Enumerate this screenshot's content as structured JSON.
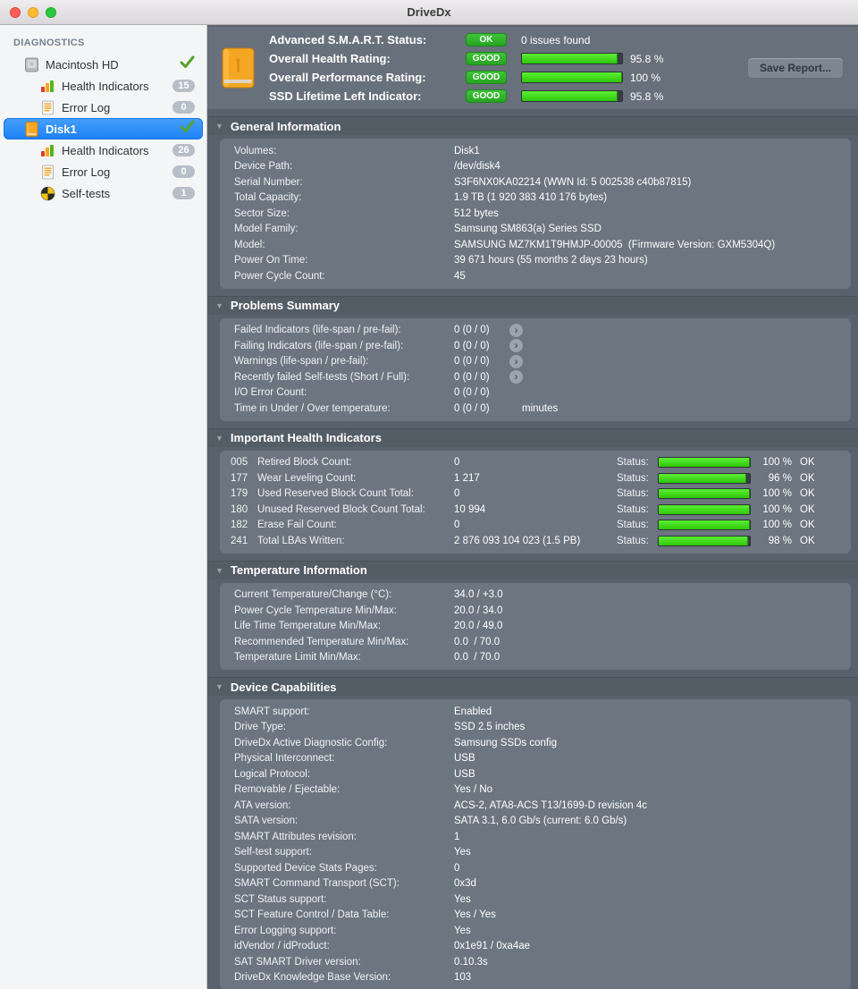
{
  "window": {
    "title": "DriveDx"
  },
  "colors": {
    "selection_blue": "#1d80f6",
    "badge_green": "#2fb529",
    "bar_green": "#3bd51c",
    "content_bg": "#59616c",
    "panel_bg": "#6c7580",
    "sidebar_bg": "#f4f5f7"
  },
  "sidebar": {
    "header": "DIAGNOSTICS",
    "items": [
      {
        "label": "Macintosh HD",
        "icon": "internal-drive",
        "level": 0,
        "check": true,
        "selected": false
      },
      {
        "label": "Health Indicators",
        "icon": "health-bars",
        "level": 1,
        "badge": "15",
        "selected": false
      },
      {
        "label": "Error Log",
        "icon": "error-log",
        "level": 1,
        "badge": "0",
        "selected": false
      },
      {
        "label": "Disk1",
        "icon": "external-drive",
        "level": 0,
        "check": true,
        "selected": true
      },
      {
        "label": "Health Indicators",
        "icon": "health-bars",
        "level": 1,
        "badge": "26",
        "selected": false
      },
      {
        "label": "Error Log",
        "icon": "error-log",
        "level": 1,
        "badge": "0",
        "selected": false
      },
      {
        "label": "Self-tests",
        "icon": "self-tests",
        "level": 1,
        "badge": "1",
        "selected": false
      }
    ]
  },
  "summary": {
    "rows": [
      {
        "label": "Advanced S.M.A.R.T. Status:",
        "badge": "OK",
        "text": "0 issues found"
      },
      {
        "label": "Overall Health Rating:",
        "badge": "GOOD",
        "percent": 95.8,
        "percent_label": "95.8 %"
      },
      {
        "label": "Overall Performance Rating:",
        "badge": "GOOD",
        "percent": 100,
        "percent_label": "100 %"
      },
      {
        "label": "SSD Lifetime Left Indicator:",
        "badge": "GOOD",
        "percent": 95.8,
        "percent_label": "95.8 %"
      }
    ],
    "save_button": "Save Report..."
  },
  "sections": [
    {
      "title": "General Information",
      "type": "kv",
      "rows": [
        [
          "Volumes:",
          "Disk1"
        ],
        [
          "Device Path:",
          "/dev/disk4"
        ],
        [
          "Serial Number:",
          "S3F6NX0KA02214 (WWN Id: 5 002538 c40b87815)"
        ],
        [
          "Total Capacity:",
          "1.9 TB (1 920 383 410 176 bytes)"
        ],
        [
          "Sector Size:",
          "512 bytes"
        ],
        [
          "Model Family:",
          "Samsung SM863(a) Series SSD"
        ],
        [
          "Model:",
          "SAMSUNG MZ7KM1T9HMJP-00005  (Firmware Version: GXM5304Q)"
        ],
        [
          "Power On Time:",
          "39 671 hours (55 months 2 days 23 hours)"
        ],
        [
          "Power Cycle Count:",
          "45"
        ]
      ]
    },
    {
      "title": "Problems Summary",
      "type": "problems",
      "rows": [
        {
          "label": "Failed Indicators (life-span / pre-fail):",
          "value": "0 (0 / 0)",
          "arrow": true
        },
        {
          "label": "Failing Indicators (life-span / pre-fail):",
          "value": "0 (0 / 0)",
          "arrow": true
        },
        {
          "label": "Warnings (life-span / pre-fail):",
          "value": "0 (0 / 0)",
          "arrow": true
        },
        {
          "label": "Recently failed Self-tests (Short / Full):",
          "value": "0 (0 / 0)",
          "arrow": true
        },
        {
          "label": "I/O Error Count:",
          "value": "0 (0 / 0)",
          "arrow": false
        },
        {
          "label": "Time in Under / Over temperature:",
          "value": "0 (0 / 0)",
          "arrow": false,
          "suffix": "minutes"
        }
      ]
    },
    {
      "title": "Important Health Indicators",
      "type": "health",
      "status_label": "Status:",
      "rows": [
        {
          "id": "005",
          "label": "Retired Block Count:",
          "value": "0",
          "percent": 100,
          "percent_label": "100 %",
          "status": "OK"
        },
        {
          "id": "177",
          "label": "Wear Leveling Count:",
          "value": "1 217",
          "percent": 96,
          "percent_label": "96 %",
          "status": "OK"
        },
        {
          "id": "179",
          "label": "Used Reserved Block Count Total:",
          "value": "0",
          "percent": 100,
          "percent_label": "100 %",
          "status": "OK"
        },
        {
          "id": "180",
          "label": "Unused Reserved Block Count Total:",
          "value": "10 994",
          "percent": 100,
          "percent_label": "100 %",
          "status": "OK"
        },
        {
          "id": "182",
          "label": "Erase Fail Count:",
          "value": "0",
          "percent": 100,
          "percent_label": "100 %",
          "status": "OK"
        },
        {
          "id": "241",
          "label": "Total LBAs Written:",
          "value": "2 876 093 104 023 (1.5 PB)",
          "percent": 98,
          "percent_label": "98 %",
          "status": "OK"
        }
      ]
    },
    {
      "title": "Temperature Information",
      "type": "kv",
      "rows": [
        [
          "Current Temperature/Change (°C):",
          "34.0 / +3.0"
        ],
        [
          "Power Cycle Temperature Min/Max:",
          "20.0 / 34.0"
        ],
        [
          "Life Time Temperature Min/Max:",
          "20.0 / 49.0"
        ],
        [
          "Recommended Temperature Min/Max:",
          "0.0  / 70.0"
        ],
        [
          "Temperature Limit Min/Max:",
          "0.0  / 70.0"
        ]
      ]
    },
    {
      "title": "Device Capabilities",
      "type": "kv",
      "rows": [
        [
          "SMART support:",
          "Enabled"
        ],
        [
          "Drive Type:",
          "SSD 2.5 inches"
        ],
        [
          "DriveDx Active Diagnostic Config:",
          "Samsung SSDs config"
        ],
        [
          "Physical Interconnect:",
          "USB"
        ],
        [
          "Logical Protocol:",
          "USB"
        ],
        [
          "Removable / Ejectable:",
          "Yes / No"
        ],
        [
          "ATA version:",
          "ACS-2, ATA8-ACS T13/1699-D revision 4c"
        ],
        [
          "SATA version:",
          "SATA 3.1, 6.0 Gb/s (current: 6.0 Gb/s)"
        ],
        [
          "SMART Attributes revision:",
          "1"
        ],
        [
          "Self-test support:",
          "Yes"
        ],
        [
          "Supported Device Stats Pages:",
          "0"
        ],
        [
          "SMART Command Transport (SCT):",
          "0x3d"
        ],
        [
          "SCT Status support:",
          "Yes"
        ],
        [
          "SCT Feature Control / Data Table:",
          "Yes / Yes"
        ],
        [
          "Error Logging support:",
          "Yes"
        ],
        [
          "idVendor / idProduct:",
          "0x1e91 / 0xa4ae"
        ],
        [
          "SAT SMART Driver version:",
          "0.10.3s"
        ],
        [
          "DriveDx Knowledge Base Version:",
          "103"
        ]
      ]
    }
  ]
}
